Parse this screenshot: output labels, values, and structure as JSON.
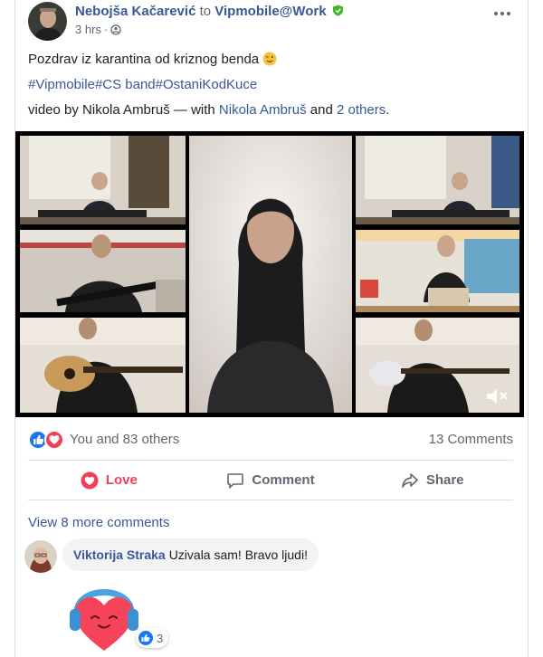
{
  "post": {
    "author": "Nebojša Kačarević",
    "to_text": "to",
    "group": "Vipmobile@Work",
    "time": "3 hrs",
    "more_icon": "more-horizontal-icon",
    "lines": {
      "greeting": "Pozdrav iz karantina od kriznog benda",
      "hashtags": "#Vipmobile#CS band#OstaniKodKuce",
      "credit_prefix": "video by Nikola Ambruš — with ",
      "tagged": "Nikola Ambruš",
      "and_text": " and ",
      "others": "2 others",
      "period": "."
    }
  },
  "stats": {
    "reactions_text": "You and 83 others",
    "comments_text": "13 Comments"
  },
  "actions": {
    "love": "Love",
    "comment": "Comment",
    "share": "Share"
  },
  "comments": {
    "view_more": "View 8 more comments",
    "items": [
      {
        "name": "Viktorija Straka",
        "text": "Uzivala sam! Bravo ljudi!"
      }
    ],
    "sticker_like_count": "3"
  },
  "colors": {
    "link": "#385898",
    "love": "#f33e58",
    "like_blue": "#1877f2",
    "muted": "#606770"
  }
}
